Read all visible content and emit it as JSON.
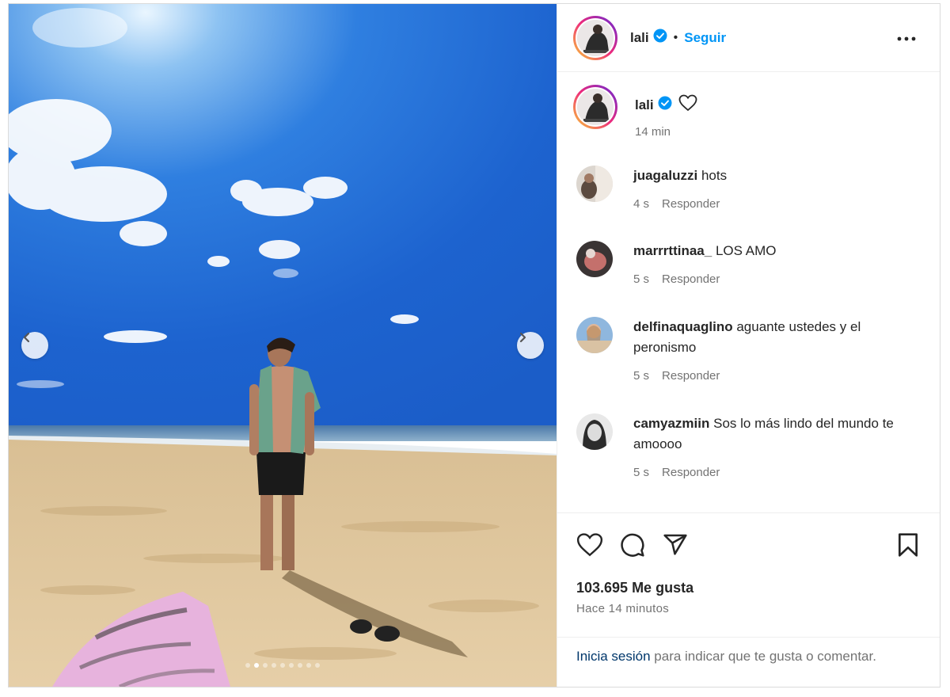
{
  "post": {
    "author": "lali",
    "follow_label": "Seguir",
    "separator": "•",
    "caption_time": "14 min",
    "likes": "103.695 Me gusta",
    "posted_ago": "Hace 14 minutos"
  },
  "comments": [
    {
      "user": "juagaluzzi",
      "text": "hots",
      "time": "4 s",
      "reply": "Responder"
    },
    {
      "user": "marrrttinaa_",
      "text": "LOS AMO",
      "time": "5 s",
      "reply": "Responder"
    },
    {
      "user": "delfinaquaglino",
      "text": "aguante ustedes y el peronismo",
      "time": "5 s",
      "reply": "Responder"
    },
    {
      "user": "camyazmiin",
      "text": "Sos lo más lindo del mundo te amoooo",
      "time": "5 s",
      "reply": "Responder"
    }
  ],
  "login_prompt": {
    "link": "Inicia sesión",
    "rest": " para indicar que te gusta o comentar."
  },
  "carousel": {
    "total_slides": 9,
    "active_slide": 2
  },
  "colors": {
    "accent": "#0095f6",
    "verified": "#0095f6",
    "muted": "#737373"
  },
  "icons": [
    "chevron-left-icon",
    "chevron-right-icon",
    "verified-badge-icon",
    "more-icon",
    "heart-icon",
    "comment-icon",
    "share-icon",
    "bookmark-icon"
  ]
}
